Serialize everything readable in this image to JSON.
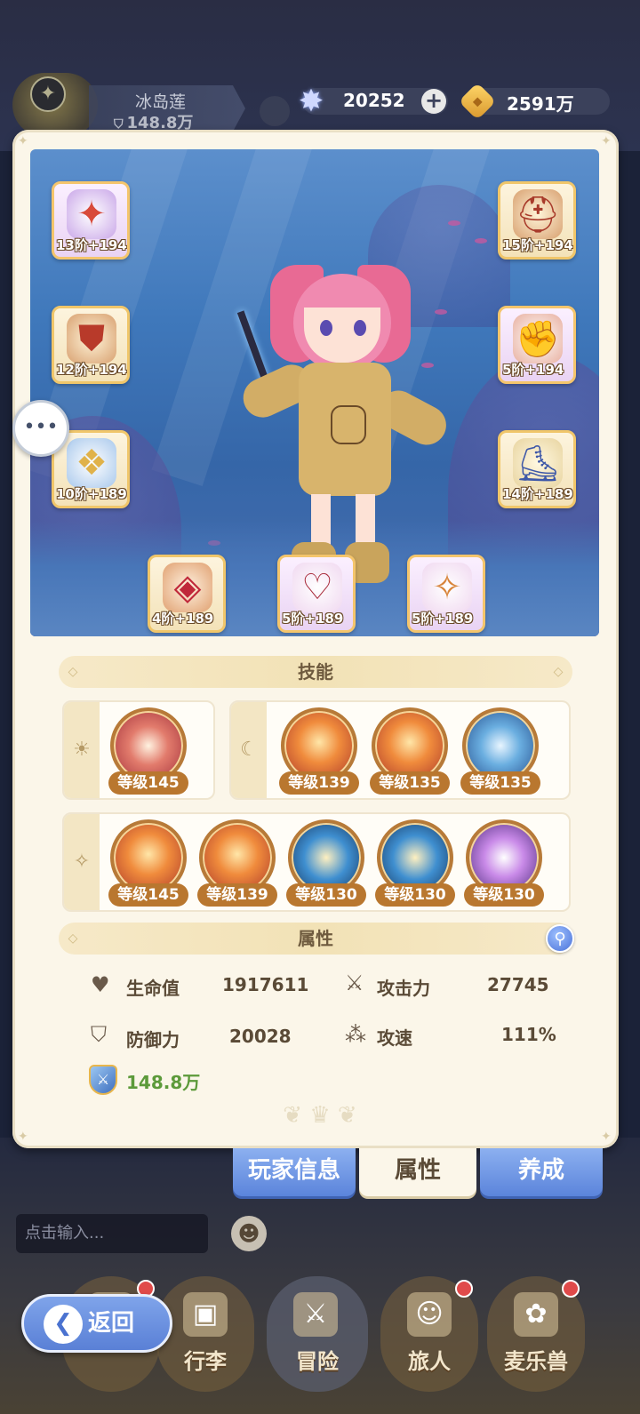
{
  "header": {
    "player_name": "冰岛莲",
    "player_power": "148.8万",
    "gems": "20252",
    "coins": "2591万"
  },
  "equipment": [
    {
      "slot": "head-accessory",
      "tier": "13阶",
      "bonus": "+194",
      "icon": "helmet-icon"
    },
    {
      "slot": "helmet",
      "tier": "15阶",
      "bonus": "+194",
      "icon": "helmet-icon"
    },
    {
      "slot": "armor",
      "tier": "12阶",
      "bonus": "+194",
      "icon": "armor-icon"
    },
    {
      "slot": "gloves",
      "tier": "5阶",
      "bonus": "+194",
      "icon": "gauntlet-icon"
    },
    {
      "slot": "belt",
      "tier": "10阶",
      "bonus": "+189",
      "icon": "belt-icon"
    },
    {
      "slot": "boots",
      "tier": "14阶",
      "bonus": "+189",
      "icon": "boots-icon"
    },
    {
      "slot": "ring",
      "tier": "4阶",
      "bonus": "+189",
      "icon": "ring-icon"
    },
    {
      "slot": "necklace",
      "tier": "5阶",
      "bonus": "+189",
      "icon": "necklace-icon"
    },
    {
      "slot": "amulet",
      "tier": "5阶",
      "bonus": "+189",
      "icon": "amulet-icon"
    }
  ],
  "skills_section": {
    "title": "技能",
    "group1": [
      {
        "level": "等级145"
      }
    ],
    "group2": [
      {
        "level": "等级139"
      },
      {
        "level": "等级135"
      },
      {
        "level": "等级135"
      }
    ],
    "group3": [
      {
        "level": "等级145"
      },
      {
        "level": "等级139"
      },
      {
        "level": "等级130"
      },
      {
        "level": "等级130"
      },
      {
        "level": "等级130"
      }
    ]
  },
  "attributes_section": {
    "title": "属性",
    "hp_label": "生命值",
    "hp_value": "1917611",
    "atk_label": "攻击力",
    "atk_value": "27745",
    "def_label": "防御力",
    "def_value": "20028",
    "spd_label": "攻速",
    "spd_value": "111%",
    "power_value": "148.8万"
  },
  "tabs": [
    "玩家信息",
    "属性",
    "养成"
  ],
  "chat": {
    "placeholder": "点击输入..."
  },
  "nav": [
    "行李",
    "冒险",
    "旅人",
    "麦乐兽"
  ],
  "back_label": "返回",
  "colors": {
    "panel_bg": "#fbf6e9",
    "tab_blue": "#5b84db",
    "level_badge": "#b9772f",
    "power_green": "#5c9a3a"
  }
}
